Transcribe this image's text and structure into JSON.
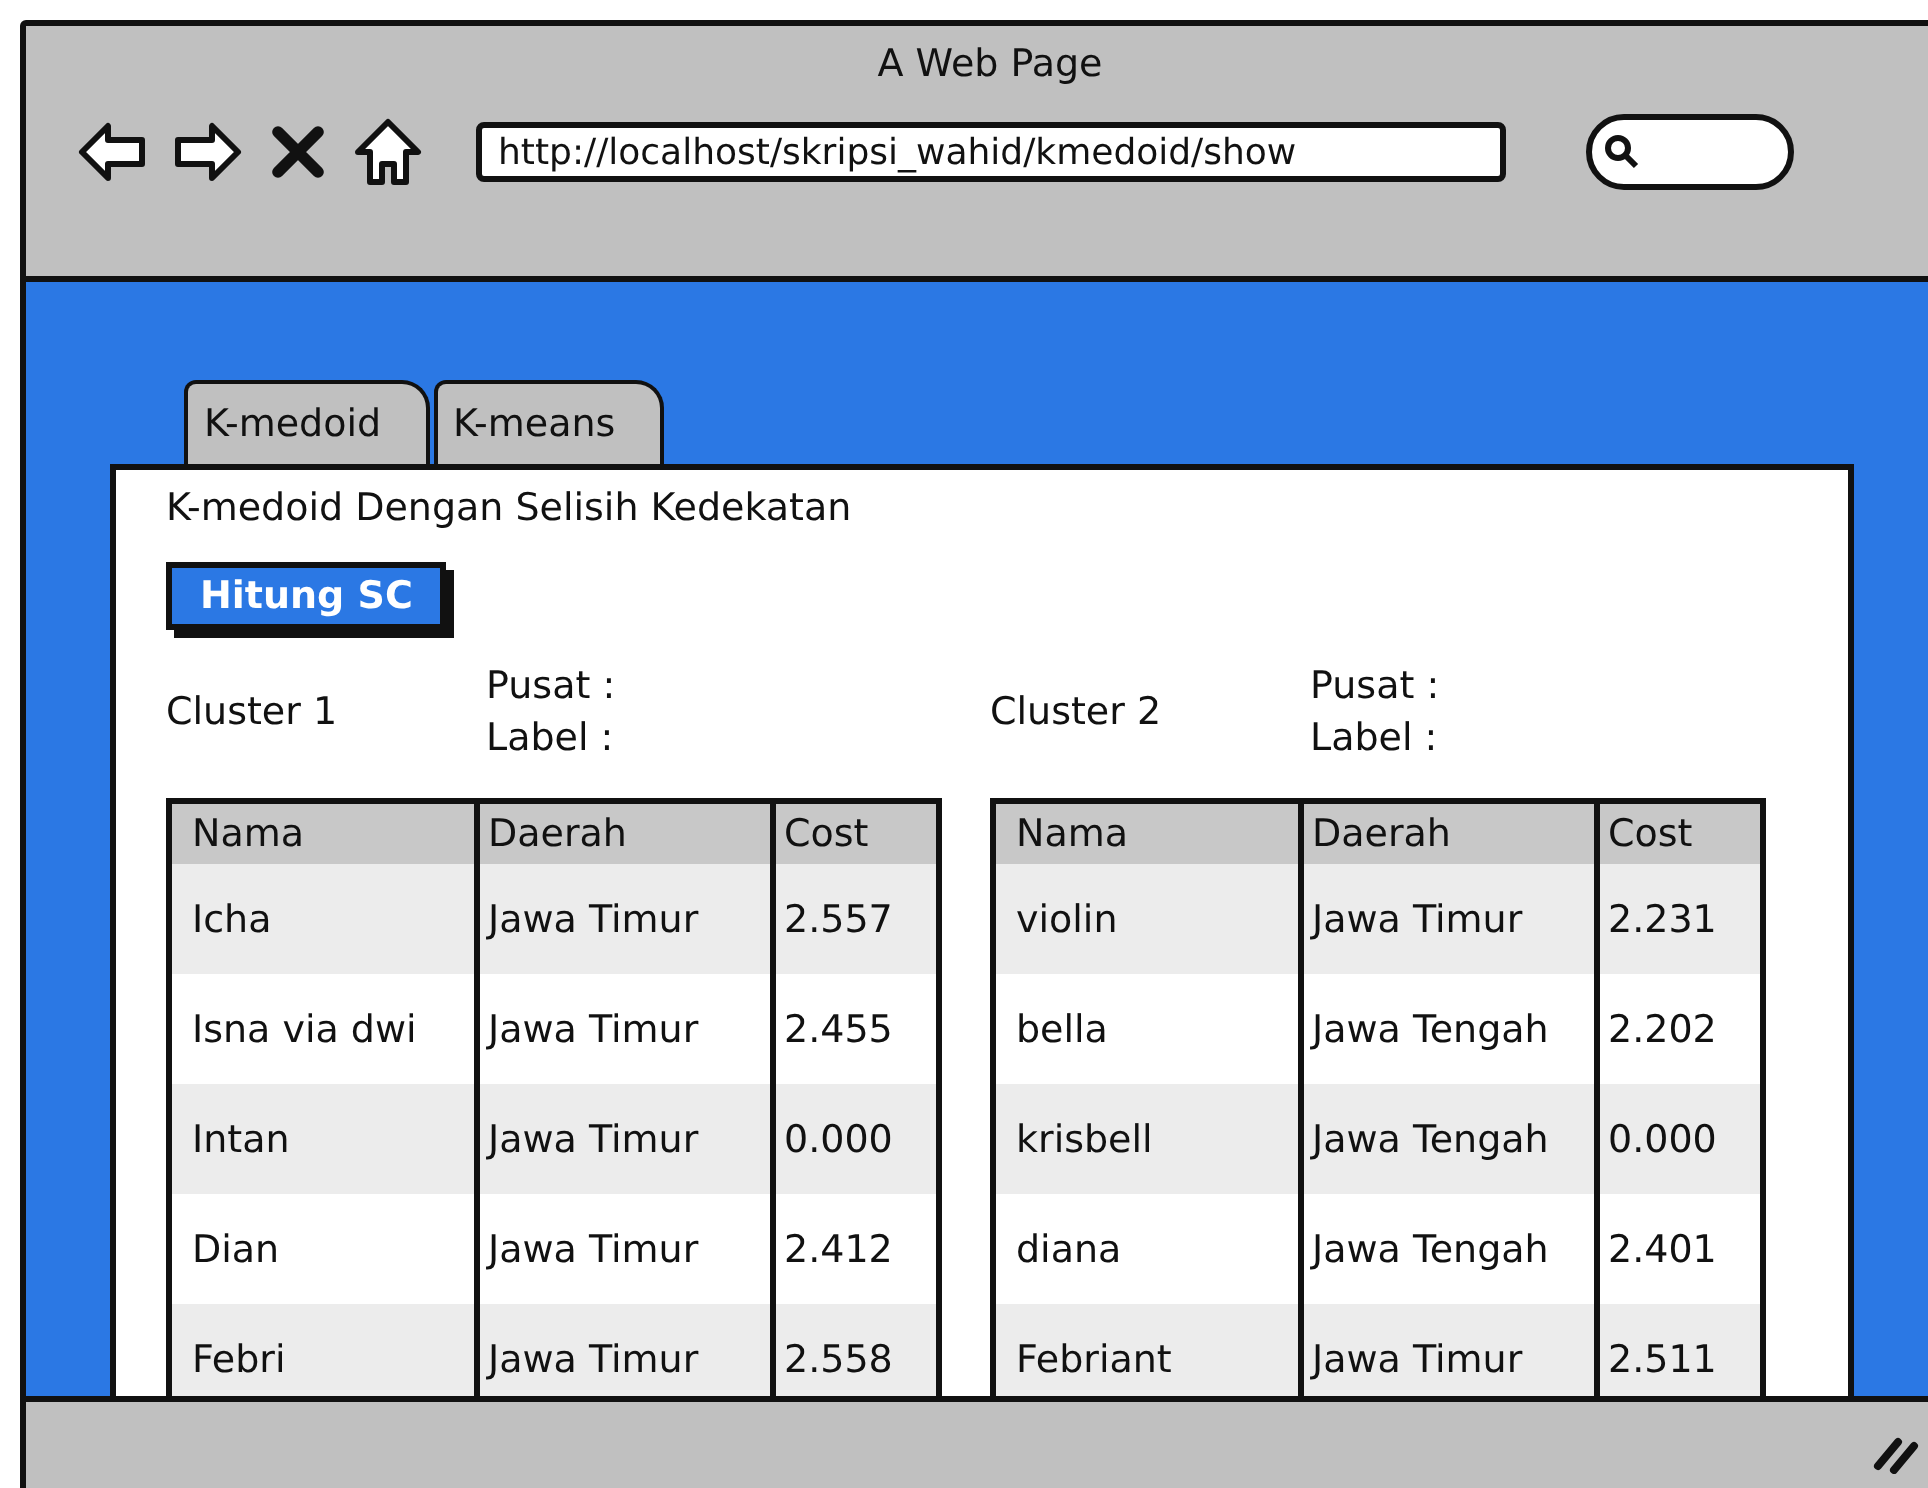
{
  "window": {
    "title": "A Web Page",
    "url": "http://localhost/skripsi_wahid/kmedoid/show"
  },
  "tabs": [
    {
      "label": "K-medoid"
    },
    {
      "label": "K-means"
    }
  ],
  "panel": {
    "title": "K-medoid Dengan Selisih Kedekatan",
    "button": "Hitung SC",
    "clusters": [
      {
        "name": "Cluster 1",
        "pusat": "Pusat :",
        "label": "Label :",
        "columns": [
          "Nama",
          "Daerah",
          "Cost"
        ],
        "rows": [
          [
            "Icha",
            "Jawa Timur",
            "2.557"
          ],
          [
            "Isna via dwi",
            "Jawa Timur",
            "2.455"
          ],
          [
            "Intan",
            "Jawa Timur",
            "0.000"
          ],
          [
            "Dian",
            "Jawa Timur",
            "2.412"
          ],
          [
            "Febri",
            "Jawa Timur",
            "2.558"
          ]
        ]
      },
      {
        "name": "Cluster 2",
        "pusat": "Pusat :",
        "label": "Label :",
        "columns": [
          "Nama",
          "Daerah",
          "Cost"
        ],
        "rows": [
          [
            "violin",
            "Jawa Timur",
            "2.231"
          ],
          [
            "bella",
            "Jawa Tengah",
            "2.202"
          ],
          [
            "krisbell",
            "Jawa Tengah",
            "0.000"
          ],
          [
            "diana",
            "Jawa Tengah",
            "2.401"
          ],
          [
            "Febriant",
            "Jawa Timur",
            "2.511"
          ]
        ]
      }
    ]
  }
}
